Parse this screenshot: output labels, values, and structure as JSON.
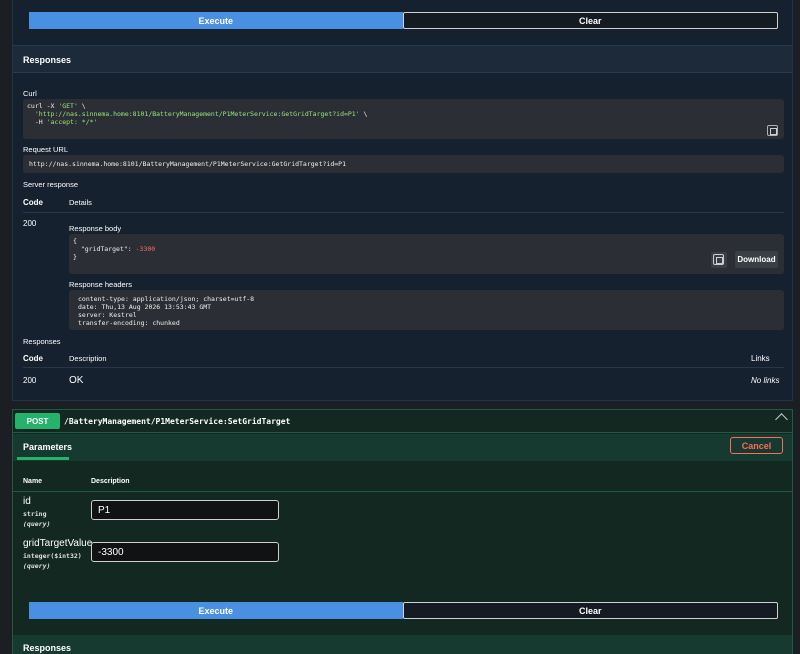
{
  "get": {
    "execute_label": "Execute",
    "clear_label": "Clear",
    "responses_title": "Responses",
    "curl_label": "Curl",
    "curl_line1_a": "curl -X ",
    "curl_line1_method": "'GET'",
    "curl_line1_b": " \\",
    "curl_line2_url": "'http://nas.sinnema.home:8101/BatteryManagement/P1MeterService:GetGridTarget?id=P1'",
    "curl_line2_b": " \\",
    "curl_line3_a": "  -H ",
    "curl_line3_header": "'accept: */*'",
    "request_url_label": "Request URL",
    "request_url": "http://nas.sinnema.home:8101/BatteryManagement/P1MeterService:GetGridTarget?id=P1",
    "server_response_label": "Server response",
    "code_header": "Code",
    "details_header": "Details",
    "response_code": "200",
    "response_body_label": "Response body",
    "body_open": "{",
    "body_key": "\"gridTarget\"",
    "body_colon": ": ",
    "body_value": "-3300",
    "body_close": "}",
    "download_label": "Download",
    "response_headers_label": "Response headers",
    "headers": [
      "content-type: application/json; charset=utf-8",
      "date: Thu,13 Aug 2026 13:53:43 GMT",
      "server: Kestrel",
      "transfer-encoding: chunked"
    ],
    "responses_label": "Responses",
    "desc_header": "Description",
    "links_header": "Links",
    "resp_code": "200",
    "resp_desc": "OK",
    "resp_links": "No links"
  },
  "post": {
    "method": "POST",
    "path": "/BatteryManagement/P1MeterService:SetGridTarget",
    "parameters_tab": "Parameters",
    "cancel_label": "Cancel",
    "name_header": "Name",
    "description_header": "Description",
    "params": [
      {
        "name": "id",
        "type": "string",
        "in": "(query)",
        "value": "P1"
      },
      {
        "name": "gridTargetValue",
        "type": "integer($int32)",
        "in": "(query)",
        "value": "-3300"
      }
    ],
    "execute_label": "Execute",
    "clear_label": "Clear",
    "responses_title": "Responses"
  }
}
